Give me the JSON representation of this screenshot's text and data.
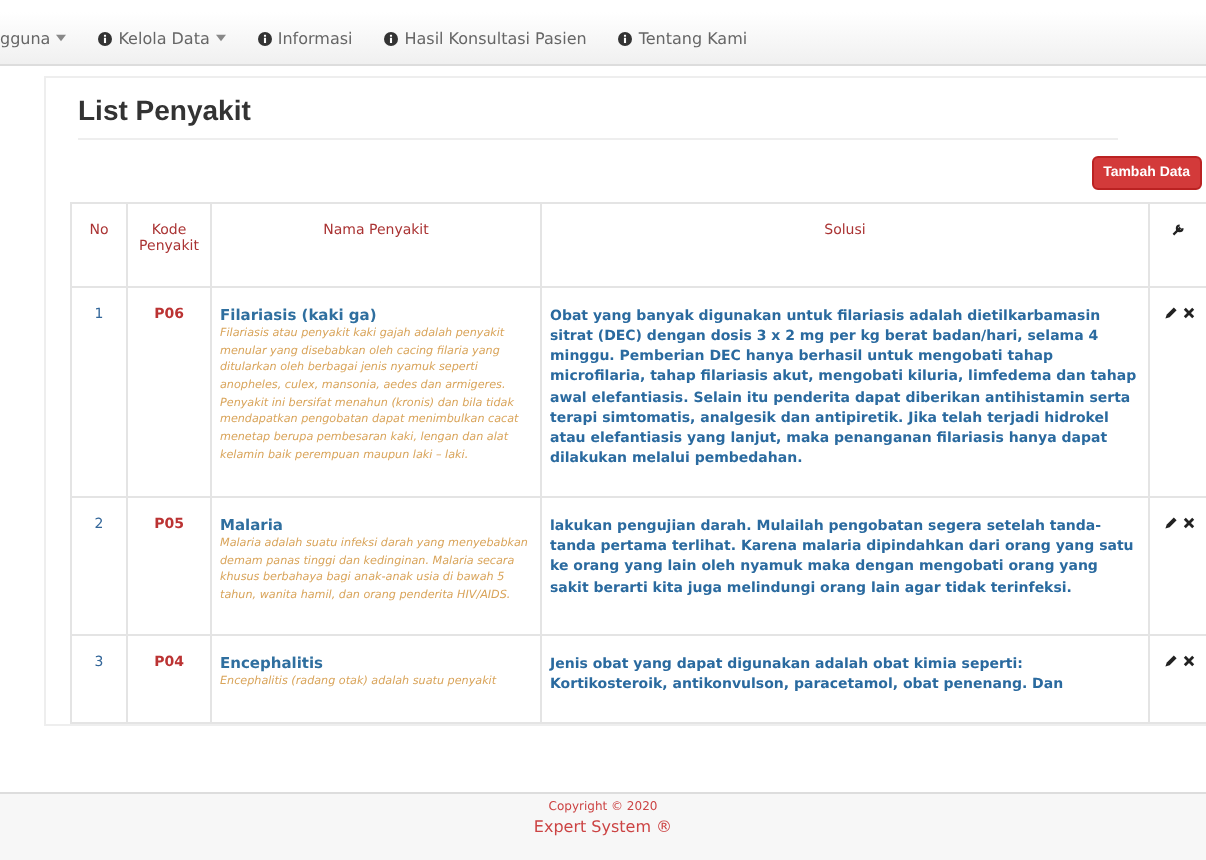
{
  "nav": [
    {
      "label": "gguna",
      "icon": false,
      "dropdown": true
    },
    {
      "label": "Kelola Data",
      "icon": true,
      "dropdown": true
    },
    {
      "label": "Informasi",
      "icon": true,
      "dropdown": false
    },
    {
      "label": "Hasil Konsultasi Pasien",
      "icon": true,
      "dropdown": false
    },
    {
      "label": "Tentang Kami",
      "icon": true,
      "dropdown": false
    }
  ],
  "page_title": "List Penyakit",
  "add_button": "Tambah Data",
  "table": {
    "columns": [
      "No",
      "Kode Penyakit",
      "Nama Penyakit",
      "Solusi"
    ],
    "rows": [
      {
        "no": "1",
        "code": "P06",
        "name": "Filariasis (kaki ga)",
        "description": "Filariasis atau penyakit kaki gajah adalah penyakit menular yang disebabkan oleh cacing filaria yang ditularkan oleh berbagai jenis nyamuk seperti anopheles, culex, mansonia, aedes dan armigeres. Penyakit ini bersifat menahun (kronis) dan bila tidak mendapatkan pengobatan dapat menimbulkan cacat menetap berupa pembesaran kaki, lengan dan alat kelamin baik perempuan maupun laki – laki.",
        "solution": "Obat yang banyak digunakan untuk filariasis adalah dietilkarbamasin sitrat (DEC) dengan dosis 3 x 2 mg per kg berat badan/hari, selama 4 minggu. Pemberian DEC hanya berhasil untuk mengobati tahap microfilaria, tahap filariasis akut, mengobati kiluria, limfedema dan tahap awal elefantiasis. Selain itu penderita dapat diberikan antihistamin serta terapi simtomatis, analgesik dan antipiretik. Jika telah terjadi hidrokel atau elefantiasis yang lanjut, maka penanganan filariasis hanya dapat dilakukan melalui pembedahan."
      },
      {
        "no": "2",
        "code": "P05",
        "name": "Malaria",
        "description": "Malaria adalah suatu infeksi darah yang menyebabkan demam panas tinggi dan kedinginan. Malaria secara khusus berbahaya bagi anak-anak usia di bawah 5 tahun, wanita hamil, dan orang penderita HIV/AIDS.",
        "solution": "lakukan pengujian darah. Mulailah pengobatan segera setelah tanda-tanda pertama terlihat. Karena malaria dipindahkan dari orang yang satu ke orang yang lain oleh nyamuk maka dengan mengobati orang yang sakit berarti kita juga melindungi orang lain agar tidak terinfeksi."
      },
      {
        "no": "3",
        "code": "P04",
        "name": "Encephalitis",
        "description": "Encephalitis (radang otak) adalah suatu penyakit",
        "solution": "Jenis obat yang dapat digunakan adalah obat kimia seperti: Kortikosteroik, antikonvulson, paracetamol, obat penenang. Dan"
      }
    ]
  },
  "footer": {
    "copyright": "Copyright © 2020",
    "brand": "Expert System ®"
  }
}
